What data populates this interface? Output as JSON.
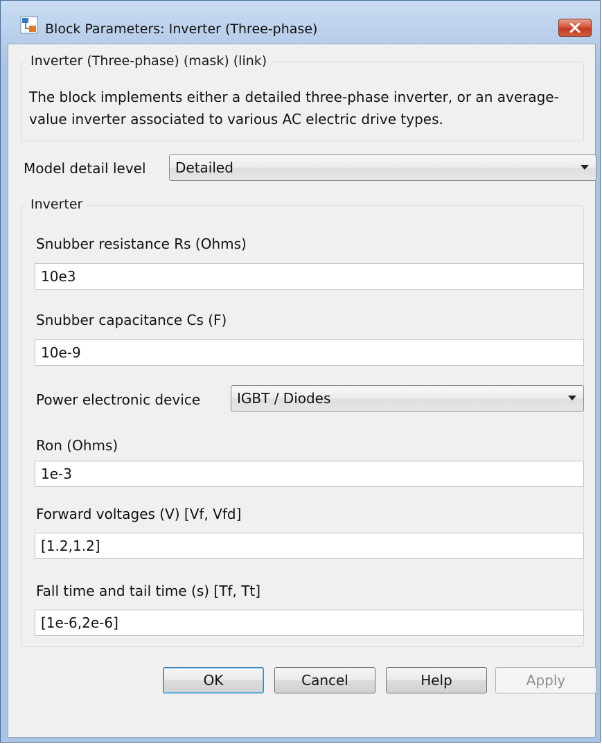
{
  "window": {
    "title": "Block Parameters: Inverter (Three-phase)",
    "icon": "simulink-block-icon",
    "close_icon": "close-icon"
  },
  "mask": {
    "legend": "Inverter (Three-phase) (mask) (link)",
    "description": "The block implements either a detailed three-phase inverter, or an average-value inverter associated to various AC electric drive types."
  },
  "model_detail_level": {
    "label": "Model detail level",
    "value": "Detailed"
  },
  "inverter": {
    "legend": "Inverter",
    "snubber_resistance": {
      "label": "Snubber resistance Rs (Ohms)",
      "value": "10e3"
    },
    "snubber_capacitance": {
      "label": "Snubber capacitance Cs (F)",
      "value": "10e-9"
    },
    "power_device": {
      "label": "Power electronic device",
      "value": "IGBT / Diodes"
    },
    "ron": {
      "label": "Ron (Ohms)",
      "value": "1e-3"
    },
    "forward_voltages": {
      "label": "Forward voltages (V) [Vf, Vfd]",
      "value": "[1.2,1.2]"
    },
    "fall_tail_time": {
      "label": "Fall time and tail time (s) [Tf, Tt]",
      "value": "[1e-6,2e-6]"
    }
  },
  "buttons": {
    "ok": "OK",
    "cancel": "Cancel",
    "help": "Help",
    "apply": "Apply"
  },
  "colors": {
    "titlebar": "#b6cde9",
    "close_button": "#c23b22",
    "client_background": "#f0f0f0"
  }
}
